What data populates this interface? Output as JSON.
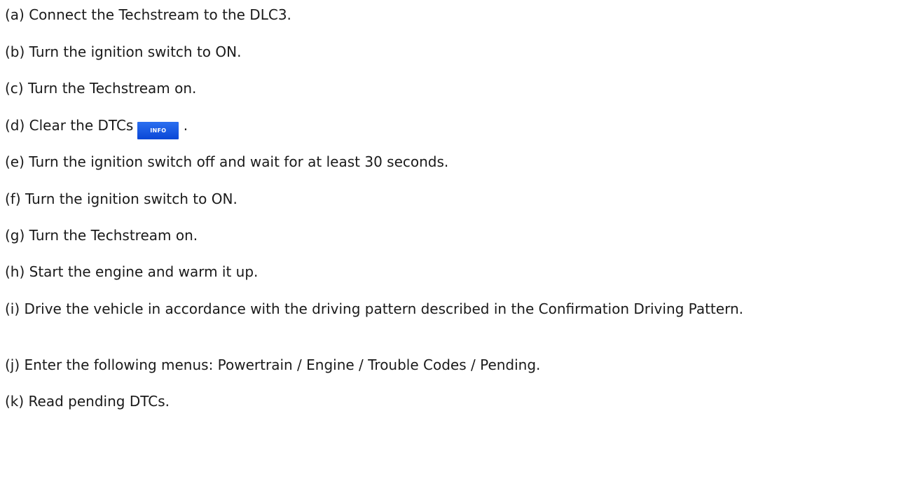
{
  "steps": [
    {
      "text": "(a) Connect the Techstream to the DLC3."
    },
    {
      "text": "(b) Turn the ignition switch to ON."
    },
    {
      "text": "(c) Turn the Techstream on."
    },
    {
      "text_before": "(d) Clear the DTCs",
      "button": "INFO",
      "text_after": "."
    },
    {
      "text": "(e) Turn the ignition switch off and wait for at least 30 seconds."
    },
    {
      "text": "(f) Turn the ignition switch to ON."
    },
    {
      "text": "(g) Turn the Techstream on."
    },
    {
      "text": "(h) Start the engine and warm it up."
    },
    {
      "text": "(i) Drive the vehicle in accordance with the driving pattern described in the Confirmation Driving Pattern."
    },
    {
      "text": "(j) Enter the following menus: Powertrain / Engine / Trouble Codes / Pending."
    },
    {
      "text": "(k) Read pending DTCs."
    }
  ],
  "colors": {
    "text": "#1a1a1a",
    "info_button": "#1456e6"
  },
  "icons": {
    "info_button": "info-button-icon"
  }
}
